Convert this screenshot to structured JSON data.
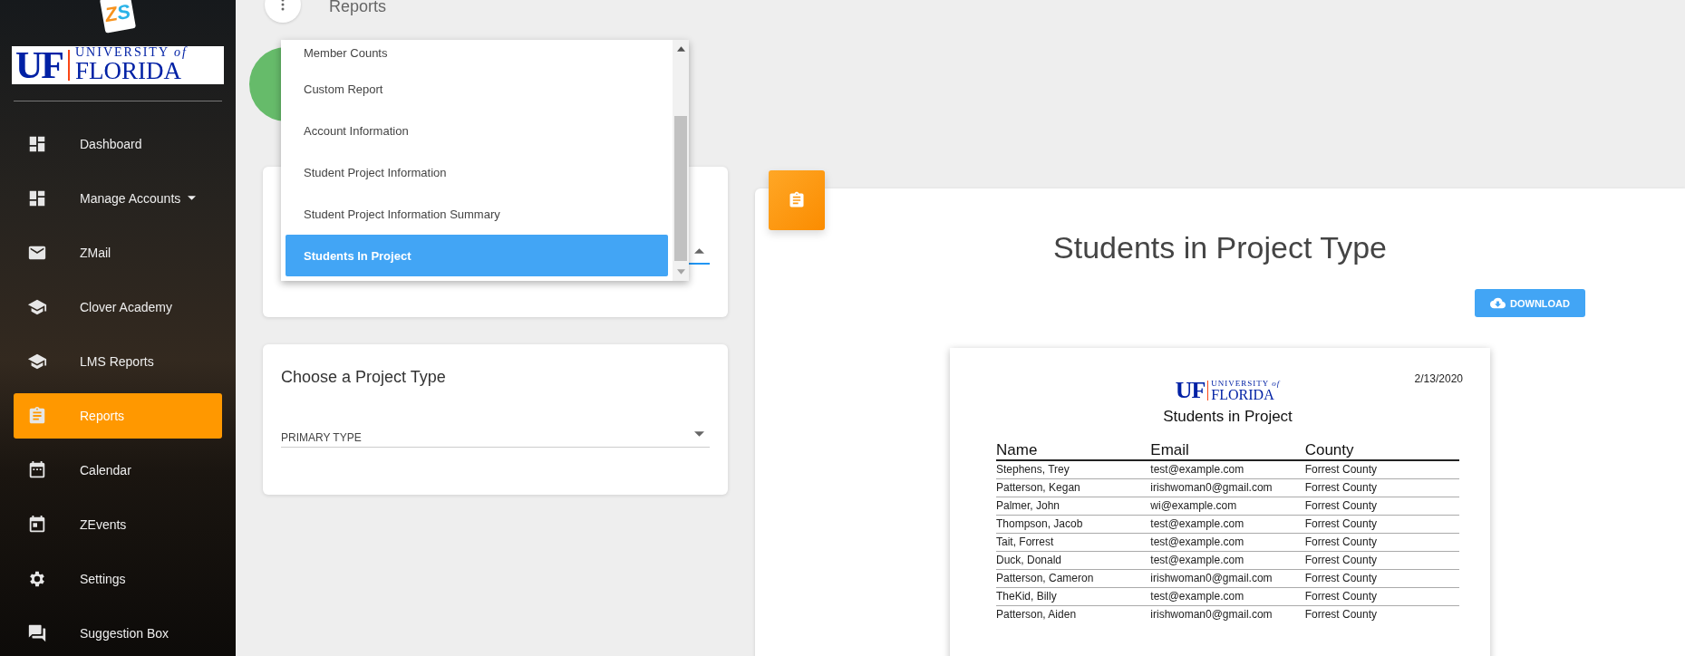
{
  "app_logo": "ZS",
  "university_logo": {
    "initials": "UF",
    "line1": "UNIVERSITY *of*",
    "line2": "FLORIDA"
  },
  "sidebar": {
    "items": [
      {
        "label": "Dashboard",
        "selected": false
      },
      {
        "label": "Manage Accounts",
        "selected": false,
        "expanded": false
      },
      {
        "label": "ZMail",
        "selected": false
      },
      {
        "label": "Clover Academy",
        "selected": false
      },
      {
        "label": "LMS Reports",
        "selected": false
      },
      {
        "label": "Reports",
        "selected": true
      },
      {
        "label": "Calendar",
        "selected": false
      },
      {
        "label": "ZEvents",
        "selected": false
      },
      {
        "label": "Settings",
        "selected": false
      },
      {
        "label": "Suggestion Box",
        "selected": false
      }
    ]
  },
  "page_title": "Reports",
  "report_select": {
    "open": true,
    "options": [
      {
        "label": "Member Counts",
        "selected": false
      },
      {
        "label": "Custom Report",
        "selected": false
      },
      {
        "label": "Account Information",
        "selected": false
      },
      {
        "label": "Student Project Information",
        "selected": false
      },
      {
        "label": "Student Project Information Summary",
        "selected": false
      },
      {
        "label": "Students In Project",
        "selected": true
      }
    ]
  },
  "project_type_card": {
    "title": "Choose a Project Type",
    "select": {
      "placeholder": "PRIMARY TYPE"
    }
  },
  "report_panel": {
    "title": "Students in Project Type",
    "download_button": "DOWNLOAD",
    "document": {
      "date": "2/13/2020",
      "logo": {
        "initials": "UF",
        "line1": "UNIVERSITY *of*",
        "line2": "FLORIDA"
      },
      "title": "Students in Project",
      "columns": [
        "Name",
        "Email",
        "County"
      ],
      "rows": [
        [
          "Stephens, Trey",
          "test@example.com",
          "Forrest County"
        ],
        [
          "Patterson, Kegan",
          "irishwoman0@gmail.com",
          "Forrest County"
        ],
        [
          "Palmer, John",
          "wi@example.com",
          "Forrest County"
        ],
        [
          "Thompson, Jacob",
          "test@example.com",
          "Forrest County"
        ],
        [
          "Tait, Forrest",
          "test@example.com",
          "Forrest County"
        ],
        [
          "Duck, Donald",
          "test@example.com",
          "Forrest County"
        ],
        [
          "Patterson, Cameron",
          "irishwoman0@gmail.com",
          "Forrest County"
        ],
        [
          "TheKid, Billy",
          "test@example.com",
          "Forrest County"
        ],
        [
          "Patterson, Aiden",
          "irishwoman0@gmail.com",
          "Forrest County"
        ]
      ]
    }
  }
}
